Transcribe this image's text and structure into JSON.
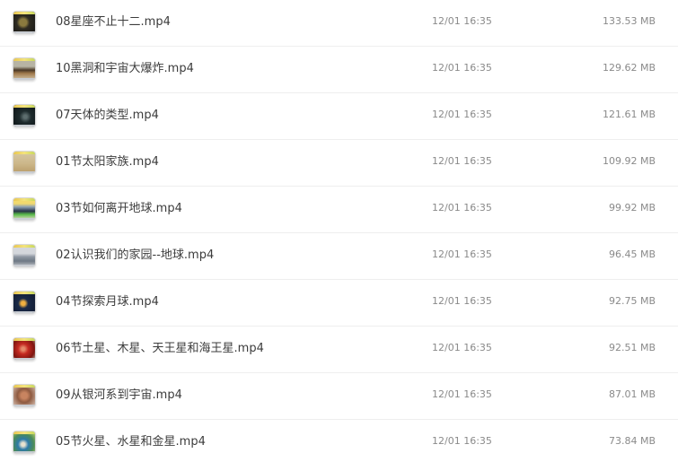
{
  "files": [
    {
      "name": "08星座不止十二.mp4",
      "time": "12/01 16:35",
      "size": "133.53 MB",
      "thumb_icon": "video-thumbnail-icon"
    },
    {
      "name": "10黑洞和宇宙大爆炸.mp4",
      "time": "12/01 16:35",
      "size": "129.62 MB",
      "thumb_icon": "video-thumbnail-icon"
    },
    {
      "name": "07天体的类型.mp4",
      "time": "12/01 16:35",
      "size": "121.61 MB",
      "thumb_icon": "video-thumbnail-icon"
    },
    {
      "name": "01节太阳家族.mp4",
      "time": "12/01 16:35",
      "size": "109.92 MB",
      "thumb_icon": "video-thumbnail-icon"
    },
    {
      "name": "03节如何离开地球.mp4",
      "time": "12/01 16:35",
      "size": "99.92 MB",
      "thumb_icon": "video-thumbnail-icon"
    },
    {
      "name": "02认识我们的家园--地球.mp4",
      "time": "12/01 16:35",
      "size": "96.45 MB",
      "thumb_icon": "video-thumbnail-icon"
    },
    {
      "name": "04节探索月球.mp4",
      "time": "12/01 16:35",
      "size": "92.75 MB",
      "thumb_icon": "video-thumbnail-icon"
    },
    {
      "name": "06节土星、木星、天王星和海王星.mp4",
      "time": "12/01 16:35",
      "size": "92.51 MB",
      "thumb_icon": "video-thumbnail-icon"
    },
    {
      "name": "09从银河系到宇宙.mp4",
      "time": "12/01 16:35",
      "size": "87.01 MB",
      "thumb_icon": "video-thumbnail-icon"
    },
    {
      "name": "05节火星、水星和金星.mp4",
      "time": "12/01 16:35",
      "size": "73.84 MB",
      "thumb_icon": "video-thumbnail-icon"
    }
  ]
}
